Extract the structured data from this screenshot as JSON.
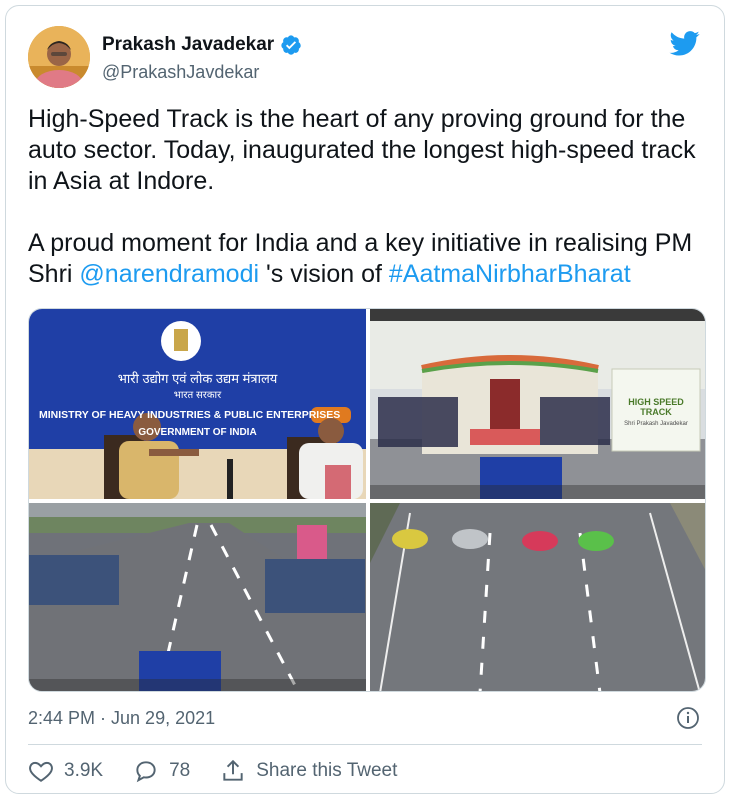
{
  "author": {
    "name": "Prakash Javadekar",
    "handle": "@PrakashJavdekar"
  },
  "tweet": {
    "line1": "High-Speed Track is the heart of any proving ground for the auto sector. Today, inaugurated the longest high-speed track in Asia at Indore.",
    "p2_prefix": "A proud moment for India and a key initiative in realising PM Shri ",
    "mention": "@narendramodi",
    "p2_middle": " 's vision of ",
    "hashtag": "#AatmaNirbharBharat"
  },
  "media": {
    "photo1": {
      "hindi_line1": "भारी उद्योग एवं लोक उद्यम मंत्रालय",
      "hindi_line2": "भारत सरकार",
      "ministry": "MINISTRY OF HEAVY INDUSTRIES & PUBLIC ENTERPRISES",
      "govt": "GOVERNMENT OF INDIA"
    },
    "photo2": {
      "banner_title": "HIGH SPEED TRACK",
      "banner_by": "Shri Prakash Javadekar"
    }
  },
  "timestamp": "2:44 PM · Jun 29, 2021",
  "actions": {
    "likes": "3.9K",
    "replies": "78",
    "share": "Share this Tweet"
  },
  "colors": {
    "link": "#1d9bf0",
    "secondary": "#536471",
    "ministry_blue": "#1f3fa6"
  },
  "icons": [
    "verified-badge-icon",
    "twitter-bird-icon",
    "info-icon",
    "heart-icon",
    "reply-icon",
    "share-icon"
  ]
}
